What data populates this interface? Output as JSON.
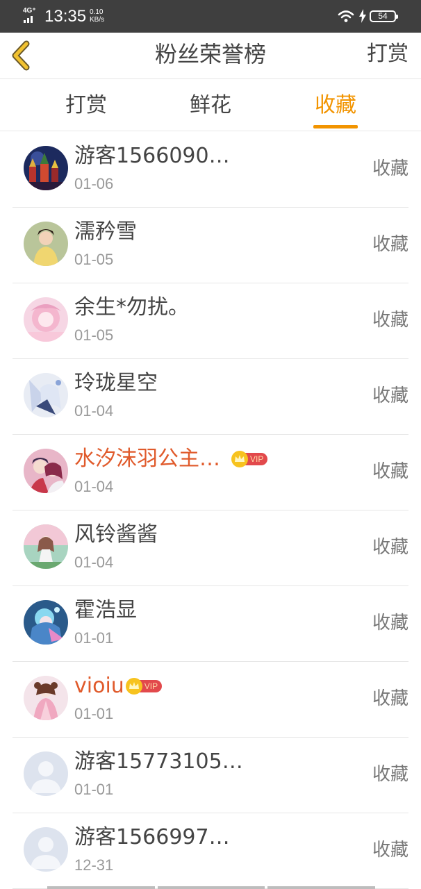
{
  "status_bar": {
    "network": "4G⁺",
    "time": "13:35",
    "speed_value": "0.10",
    "speed_unit": "KB/s",
    "battery": "54",
    "icons": [
      "signal-icon",
      "wifi-icon",
      "charging-icon",
      "battery-icon"
    ]
  },
  "nav": {
    "back_icon": "chevron-left-icon",
    "title": "粉丝荣誉榜",
    "action": "打赏"
  },
  "tabs": [
    {
      "label": "打赏",
      "active": false
    },
    {
      "label": "鲜花",
      "active": false
    },
    {
      "label": "收藏",
      "active": true
    }
  ],
  "colors": {
    "accent": "#f29400",
    "vip_name": "#e05a2b",
    "vip_badge": "#e2494c",
    "crown": "#f7c31f",
    "text": "#444444",
    "muted": "#999999"
  },
  "vip_label": "VIP",
  "fans": [
    {
      "name": "游客1566090…",
      "date": "01-06",
      "action": "收藏",
      "vip": false,
      "avatar": "avatar-night-castle"
    },
    {
      "name": "濡矜雪",
      "date": "01-05",
      "action": "收藏",
      "vip": false,
      "avatar": "avatar-girl-yellow"
    },
    {
      "name": "余生*勿扰。",
      "date": "01-05",
      "action": "收藏",
      "vip": false,
      "avatar": "avatar-pink-anime"
    },
    {
      "name": "玲珑星空",
      "date": "01-04",
      "action": "收藏",
      "vip": false,
      "avatar": "avatar-white-anime"
    },
    {
      "name": "水汐沫羽公主…",
      "date": "01-04",
      "action": "收藏",
      "vip": true,
      "avatar": "avatar-couple-anime"
    },
    {
      "name": "风铃酱酱",
      "date": "01-04",
      "action": "收藏",
      "vip": false,
      "avatar": "avatar-garden-anime"
    },
    {
      "name": "霍浩显",
      "date": "01-01",
      "action": "收藏",
      "vip": false,
      "avatar": "avatar-blue-anime"
    },
    {
      "name": "vioiu",
      "date": "01-01",
      "action": "收藏",
      "vip": true,
      "avatar": "avatar-princess-anime"
    },
    {
      "name": "游客15773105…",
      "date": "01-01",
      "action": "收藏",
      "vip": false,
      "avatar": "default-user-icon"
    },
    {
      "name": "游客1566997…",
      "date": "12-31",
      "action": "收藏",
      "vip": false,
      "avatar": "default-user-icon"
    }
  ]
}
